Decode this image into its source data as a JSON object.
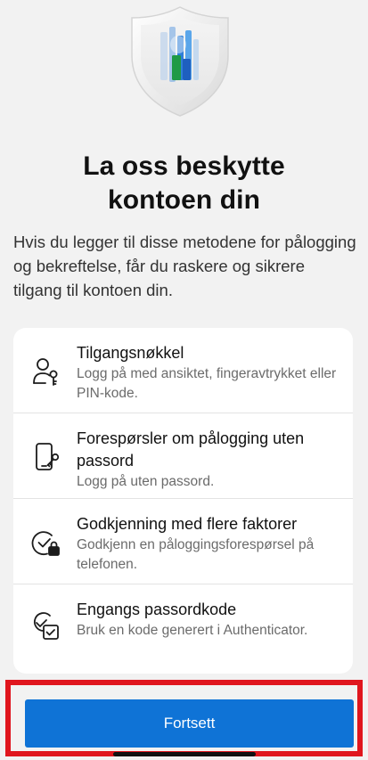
{
  "header": {
    "hero_image": "shield-logo-icon"
  },
  "title": {
    "line1": "La oss beskytte",
    "line2": "kontoen din"
  },
  "intro": "Hvis du legger til disse metodene for pålogging og bekreftelse, får du raskere og sikrere tilgang til kontoen din.",
  "methods": [
    {
      "icon": "passkey-person-icon",
      "title": "Tilgangsnøkkel",
      "description": "Logg på med ansiktet, fingeravtrykket eller PIN-kode."
    },
    {
      "icon": "phone-key-icon",
      "title": "Forespørsler om pålogging uten passord",
      "description": "Logg på uten passord."
    },
    {
      "icon": "check-lock-icon",
      "title": "Godkjenning med flere faktorer",
      "description": "Godkjenn en påloggingsforespørsel på telefonen."
    },
    {
      "icon": "one-time-code-icon",
      "title": "Engangs passordkode",
      "description": "Bruk en kode generert i Authenticator."
    }
  ],
  "footer": {
    "continue_label": "Fortsett"
  },
  "colors": {
    "background": "#f2f2f2",
    "card": "#ffffff",
    "primary_button": "#0f73d6",
    "highlight_border": "#e0161e"
  }
}
